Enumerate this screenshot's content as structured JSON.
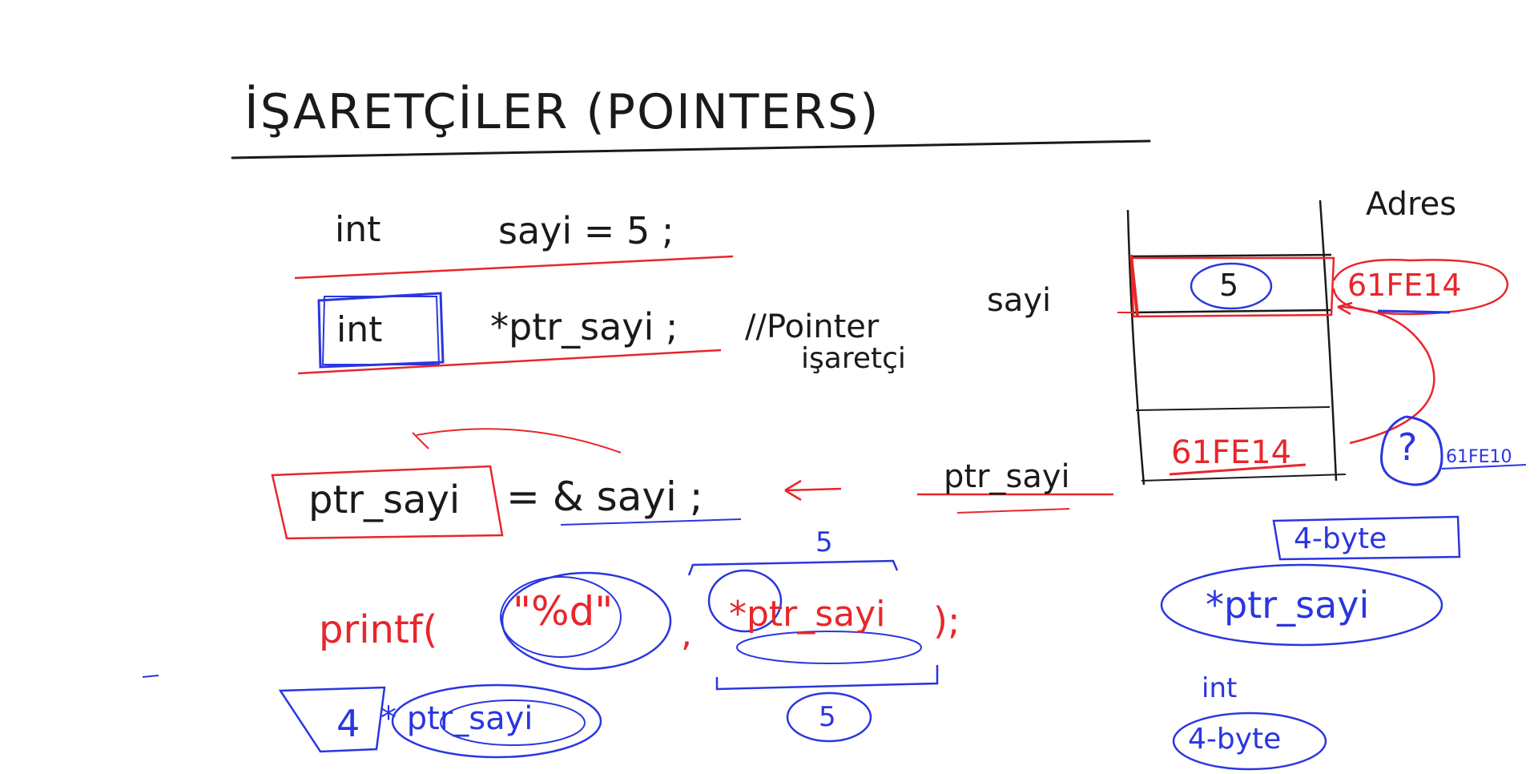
{
  "colors": {
    "black_ink": "#1a1a1a",
    "red_ink": "#e8262b",
    "blue_ink": "#2a36e0",
    "background": "#ffffff"
  },
  "title": "İŞARETÇİLER (POINTERS)",
  "code": {
    "line1_type": "int",
    "line1_decl": "sayi = 5 ;",
    "line2_type": "int",
    "line2_decl": "*ptr_sayi ;",
    "line2_comment": "//Pointer",
    "line2_comment2": "işaretçi",
    "line3_left": "ptr_sayi",
    "line3_right": "= & sayi ;",
    "line4_printf": "printf(",
    "line4_format": "\"%d\"",
    "line4_comma": ",",
    "line4_deref": "*ptr_sayi",
    "line4_end": ");",
    "printf_result_above": "5",
    "printf_result_below": "5",
    "bottom_left_prefix": "4",
    "bottom_left_deref": "* ptr_sayi"
  },
  "memory": {
    "header": "Adres",
    "cell1_label": "sayi",
    "cell1_value": "5",
    "cell1_address": "61FE14",
    "cell2_label": "ptr_sayi",
    "cell2_value": "61FE14",
    "cell2_unknown": "?",
    "cell2_address": "61FE10"
  },
  "notes": {
    "size_note_1": "4-byte",
    "deref_note": "*ptr_sayi",
    "int_label": "int",
    "size_note_2": "4-byte"
  }
}
